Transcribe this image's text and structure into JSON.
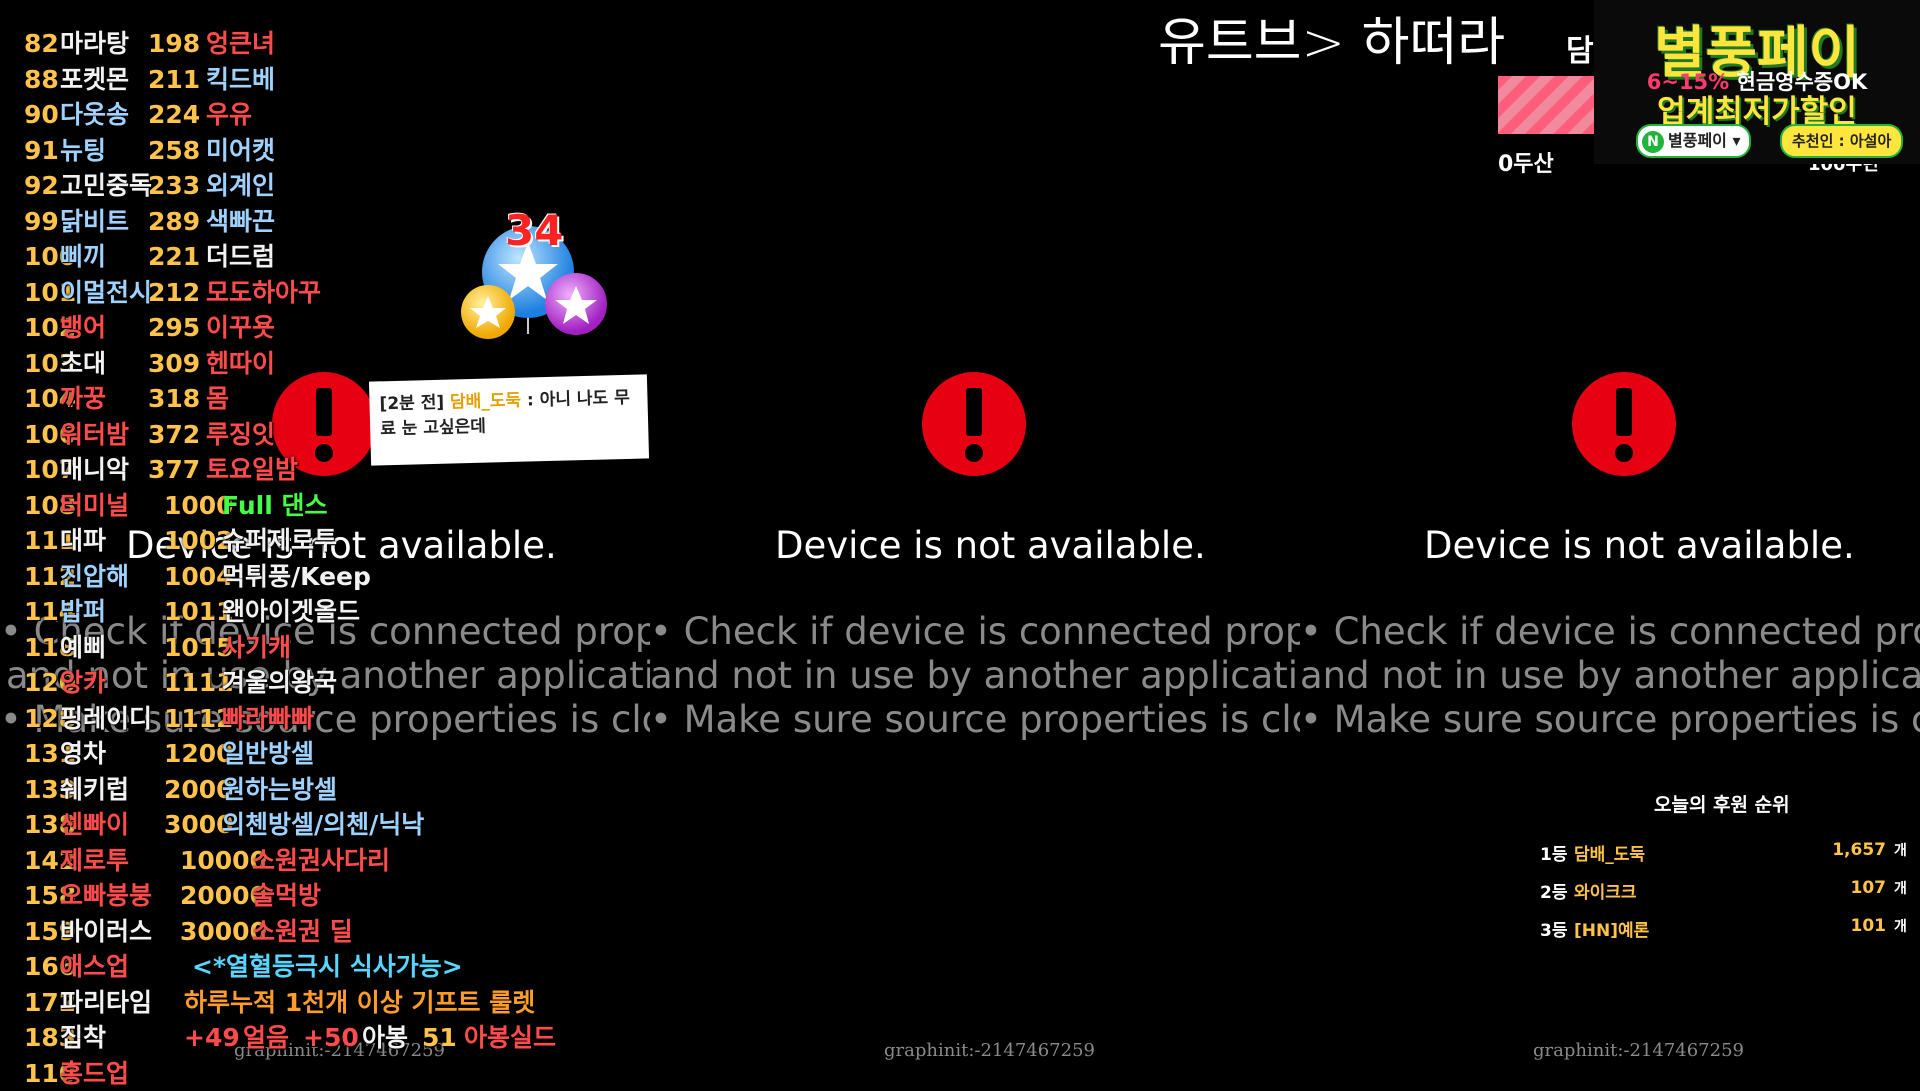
{
  "menu": [
    {
      "n1": "82",
      "l1": "마라탕",
      "c1": "w",
      "n2": "198",
      "l2": "엉큰녀",
      "c2": "r"
    },
    {
      "n1": "88",
      "l1": "포켓몬",
      "c1": "w",
      "n2": "211",
      "l2": "킥드베",
      "c2": "lb"
    },
    {
      "n1": "90",
      "l1": "다옷송",
      "c1": "lb",
      "n2": "224",
      "l2": "우유",
      "c2": "r"
    },
    {
      "n1": "91",
      "l1": "뉴팅",
      "c1": "lb",
      "n2": "258",
      "l2": "미어캣",
      "c2": "lb"
    },
    {
      "n1": "92",
      "l1": "고민중독",
      "c1": "w",
      "n2": "233",
      "l2": "외계인",
      "c2": "lb"
    },
    {
      "n1": "99",
      "l1": "닭비트",
      "c1": "lb",
      "n2": "289",
      "l2": "색빠끈",
      "c2": "lb"
    },
    {
      "n1": "100",
      "l1": "삐끼",
      "c1": "lb",
      "n2": "221",
      "l2": "더드럼",
      "c2": "w"
    },
    {
      "n1": "101",
      "l1": "이멀전시",
      "c1": "lb",
      "n2": "212",
      "l2": "모도하아꾸",
      "c2": "r"
    },
    {
      "n1": "102",
      "l1": "뱅어",
      "c1": "r",
      "n2": "295",
      "l2": "이꾸욧",
      "c2": "r"
    },
    {
      "n1": "103",
      "l1": "초대",
      "c1": "w",
      "n2": "309",
      "l2": "헨따이",
      "c2": "r"
    },
    {
      "n1": "104",
      "l1": "까꿍",
      "c1": "r",
      "n2": "318",
      "l2": "몸",
      "c2": "r"
    },
    {
      "n1": "106",
      "l1": "워터밤",
      "c1": "r",
      "n2": "372",
      "l2": "루징잇",
      "c2": "r"
    },
    {
      "n1": "107",
      "l1": "매니악",
      "c1": "w",
      "n2": "377",
      "l2": "토요일밤",
      "c2": "r"
    },
    {
      "n1": "108",
      "l1": "터미널",
      "c1": "r",
      "n2": "1000",
      "l2": "Full 댄스",
      "c2": "g"
    },
    {
      "n1": "111",
      "l1": "대파",
      "c1": "w",
      "n2": "1002",
      "l2": "슈퍼제로투",
      "c2": "w"
    },
    {
      "n1": "112",
      "l1": "진압해",
      "c1": "lb",
      "n2": "1004",
      "l2": "먹튀풍/Keep",
      "c2": "w"
    },
    {
      "n1": "114",
      "l1": "밥퍼",
      "c1": "lb",
      "n2": "1011",
      "l2": "왠아이겟올드",
      "c2": "w"
    },
    {
      "n1": "118",
      "l1": "예삐",
      "c1": "w",
      "n2": "1015",
      "l2": "사기캐",
      "c2": "r"
    },
    {
      "n1": "120",
      "l1": "앙카",
      "c1": "r",
      "n2": "1111",
      "l2": "겨울의왕국",
      "c2": "w"
    },
    {
      "n1": "128",
      "l1": "핑레이디",
      "c1": "w",
      "n2": "1112",
      "l2": "빠라빠빠",
      "c2": "r"
    },
    {
      "n1": "131",
      "l1": "영차",
      "c1": "w",
      "n2": "1200",
      "l2": "일반방셀",
      "c2": "lb"
    },
    {
      "n1": "133",
      "l1": "쉐키럽",
      "c1": "w",
      "n2": "2000",
      "l2": "원하는방셀",
      "c2": "lb"
    },
    {
      "n1": "138",
      "l1": "센빠이",
      "c1": "r",
      "n2": "3000",
      "l2": "의첸방셀/의첸/닉낙",
      "c2": "lb"
    },
    {
      "n1": "142",
      "l1": "제로투",
      "c1": "r",
      "n2": "10000",
      "l2": "소원권사다리",
      "c2": "r"
    },
    {
      "n1": "158",
      "l1": "오빠붕붕",
      "c1": "r",
      "n2": "20000",
      "l2": "술먹방",
      "c2": "r"
    },
    {
      "n1": "159",
      "l1": "바이러스",
      "c1": "w",
      "n2": "30000",
      "l2": "소원권 딜",
      "c2": "r"
    }
  ],
  "menu_tail": [
    {
      "n1": "166",
      "l1": "애스업",
      "c1": "r",
      "text": "<*열혈등극시 식사가능>",
      "ct": "c"
    },
    {
      "n1": "172",
      "l1": "파리타임",
      "c1": "w",
      "text": "하루누적 1천개 이상 기프트 룰렛",
      "ct": "o"
    },
    {
      "n1": "183",
      "l1": "집착",
      "c1": "w",
      "p1": "+49",
      "t1": "얼음",
      "p2": "+50",
      "t2": "아봉",
      "p3": "51",
      "t3": "아봉실드"
    },
    {
      "n1": "110",
      "l1": "홍드업",
      "c1": "r"
    }
  ],
  "devices": [
    {
      "message": "Device is not available.",
      "hint1": "• Check if device is connected properly",
      "hint2": "and not in use by another application",
      "hint3": "• Make sure source properties is closed",
      "graph": "graphinit:-2147467259"
    },
    {
      "message": "Device is not available.",
      "hint1": "• Check if device is connected properl",
      "hint2": "and not in use by another application",
      "hint3": "• Make sure source properties is close",
      "graph": "graphinit:-2147467259"
    },
    {
      "message": "Device is not available.",
      "hint1": "• Check if device is connected prope",
      "hint2": "and not in use by another applicatio",
      "hint3": "• Make sure source properties is clos",
      "graph": "graphinit:-2147467259"
    }
  ],
  "header": {
    "youtube": "유트브> 하떠라",
    "dam": "담",
    "zero": "0두산",
    "peek": "100주년"
  },
  "ad": {
    "title": "별풍페이",
    "line1_pct": "6~15%",
    "line1_rest": " 현금영수증OK",
    "line2": "업계최저가할인",
    "btn1": "별풍페이",
    "btn1_logo": "N",
    "btn2": "추천인 : 아설아"
  },
  "chat": {
    "time": "[2분 전]",
    "nick": "담배_도둑",
    "sep": " : ",
    "msg": "아니 나도 무료 눈 고싶은데"
  },
  "balloon": {
    "count": "34"
  },
  "ranking": {
    "title": "오늘의 후원 순위",
    "unit": "개",
    "rows": [
      {
        "pos": "1등",
        "name": "담배_도둑",
        "amount": "1,657"
      },
      {
        "pos": "2등",
        "name": "와이크크",
        "amount": "107"
      },
      {
        "pos": "3등",
        "name": "[HN]예론",
        "amount": "101"
      }
    ]
  },
  "colors": {
    "alert": "#e60012",
    "yellow": "#ffc24a",
    "red": "#ff4b4b",
    "green": "#44ff44",
    "lightblue": "#9fd2ff"
  }
}
